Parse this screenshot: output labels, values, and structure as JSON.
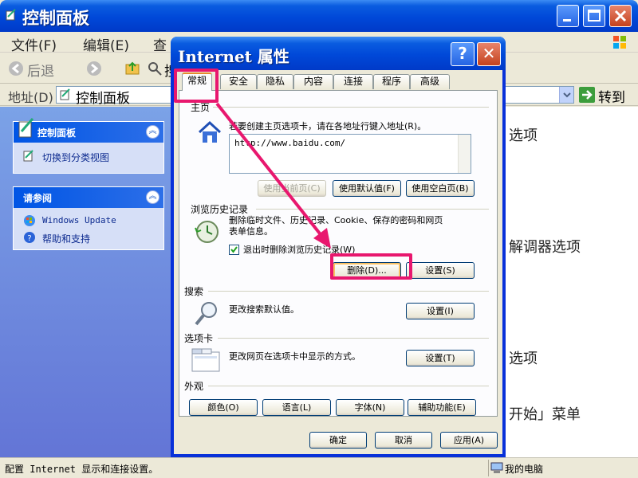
{
  "control_panel": {
    "title": "控制面板",
    "menu": [
      "文件(F)",
      "编辑(E)",
      "查"
    ],
    "toolbar": {
      "back_label": "后退",
      "partial_label": "搜"
    },
    "address": {
      "label": "地址(D)",
      "value": "控制面板",
      "go_label": "转到"
    },
    "sidebar": {
      "panel_title": "控制面板",
      "switch_view": "切换到分类视图",
      "see_also_title": "请参阅",
      "see_also_items": [
        "Windows Update",
        "帮助和支持"
      ]
    },
    "background_items": [
      "选项",
      "解调器选项",
      "选项",
      "开始」菜单"
    ],
    "status": {
      "text": "配置 Internet 显示和连接设置。",
      "zone": "我的电脑"
    }
  },
  "dialog": {
    "title": "Internet 属性",
    "help_glyph": "?",
    "close_glyph": "✕",
    "tabs": [
      "常规",
      "安全",
      "隐私",
      "内容",
      "连接",
      "程序",
      "高级"
    ],
    "active_tab": "常规",
    "homepage": {
      "group_title": "主页",
      "description": "若要创建主页选项卡，请在各地址行键入地址(R)。",
      "url": "http://www.baidu.com/",
      "use_current": "使用当前页(C)",
      "use_default": "使用默认值(F)",
      "use_blank": "使用空白页(B)"
    },
    "history": {
      "group_title": "浏览历史记录",
      "description_1": "删除临时文件、历史记录、Cookie、保存的密码和网页",
      "description_2": "表单信息。",
      "checkbox_label": "退出时删除浏览历史记录(W)",
      "checkbox_checked": true,
      "delete_button": "删除(D)...",
      "settings_button": "设置(S)"
    },
    "search": {
      "group_title": "搜索",
      "description": "更改搜索默认值。",
      "settings_button": "设置(I)"
    },
    "tabs_group": {
      "group_title": "选项卡",
      "description": "更改网页在选项卡中显示的方式。",
      "settings_button": "设置(T)"
    },
    "appearance": {
      "group_title": "外观",
      "colors": "颜色(O)",
      "languages": "语言(L)",
      "fonts": "字体(N)",
      "accessibility": "辅助功能(E)"
    },
    "footer": {
      "ok": "确定",
      "cancel": "取消",
      "apply": "应用(A)"
    }
  },
  "colors": {
    "highlight": "#e8176e",
    "title_blue": "#0048d8",
    "face": "#ece9d8"
  }
}
